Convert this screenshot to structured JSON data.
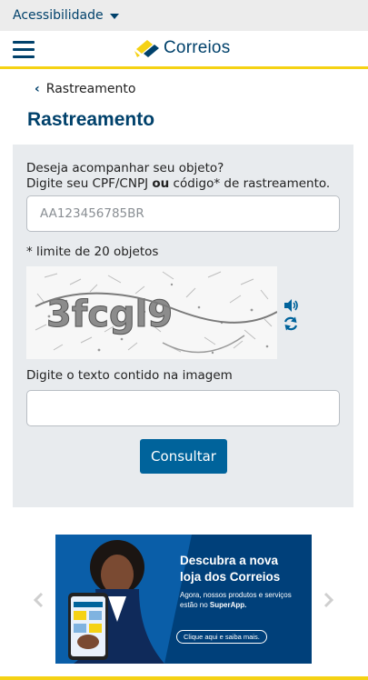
{
  "accessibility": {
    "label": "Acessibilidade"
  },
  "header": {
    "logo_text": "Correios"
  },
  "breadcrumb": {
    "back_label": "Rastreamento"
  },
  "page": {
    "title": "Rastreamento"
  },
  "form": {
    "intro_line1": "Deseja acompanhar seu objeto?",
    "intro_line2_prefix": "Digite seu CPF/CNPJ ",
    "intro_line2_bold": "ou",
    "intro_line2_suffix": " código* de rastreamento.",
    "code_placeholder": "AA123456785BR",
    "limit_note": "* limite de 20 objetos",
    "captcha_text": "3fcgl9",
    "captcha_label": "Digite o texto contido na imagem",
    "submit_label": "Consultar"
  },
  "banner": {
    "title_line1": "Descubra a nova",
    "title_line2": "loja dos Correios",
    "sub_prefix": "Agora, nossos produtos e serviços estão no ",
    "sub_bold": "SuperApp.",
    "cta": "Clique aqui e saiba mais."
  },
  "colors": {
    "brand_blue": "#00416b",
    "accent_yellow": "#f5d214",
    "button_blue": "#00639b"
  },
  "icons": [
    "chevron-down-icon",
    "menu-icon",
    "correios-logo-icon",
    "chevron-left-icon",
    "audio-icon",
    "refresh-icon",
    "chevron-right-icon"
  ]
}
